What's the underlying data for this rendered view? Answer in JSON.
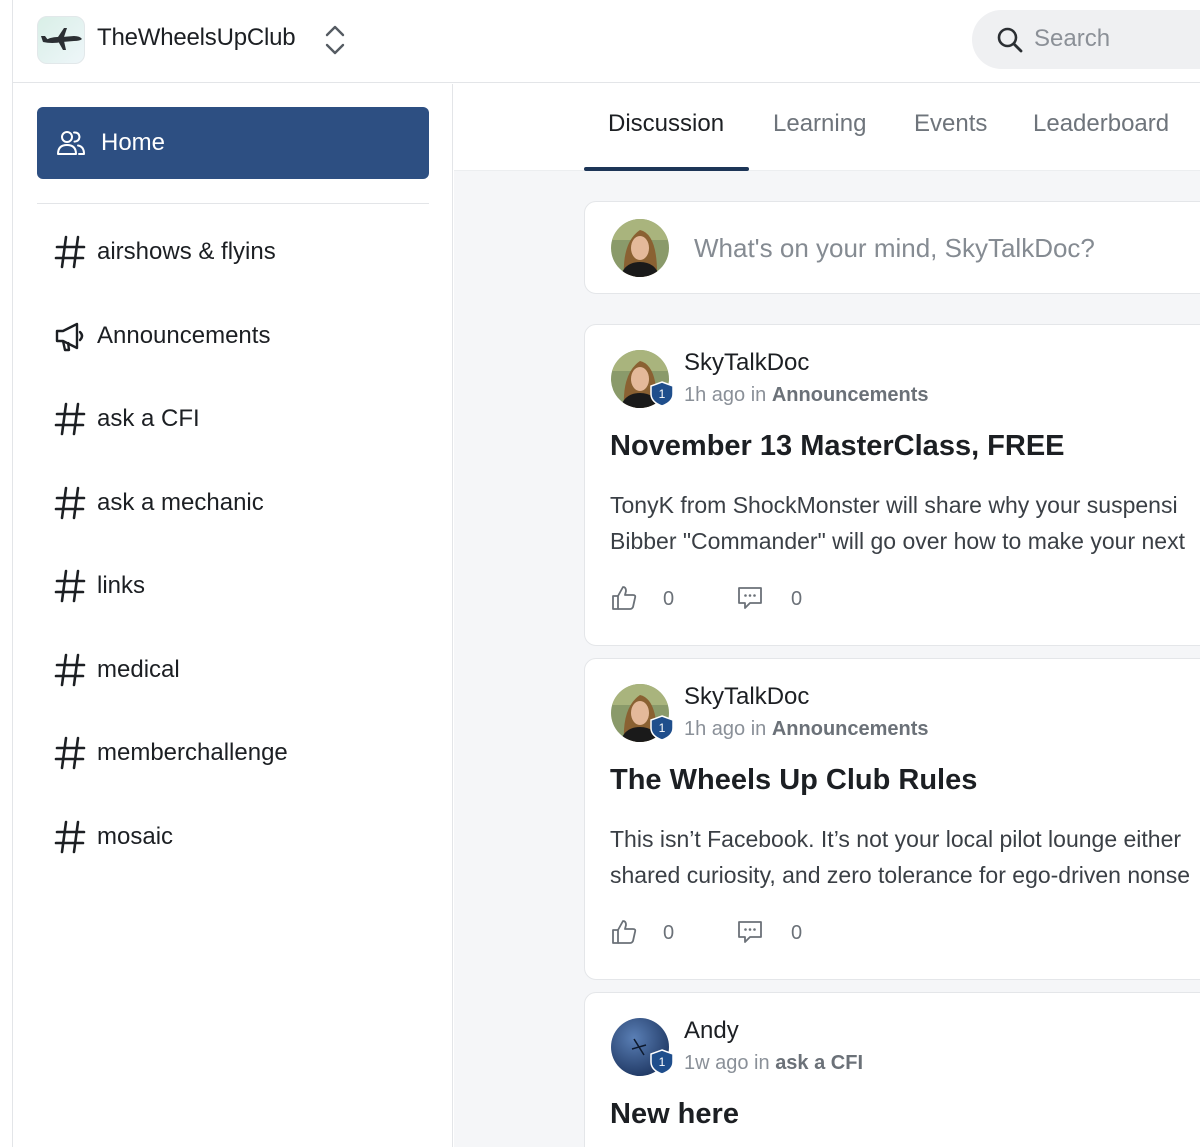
{
  "header": {
    "community_name": "TheWheelsUpClub",
    "search_placeholder": "Search"
  },
  "sidebar": {
    "home_label": "Home",
    "spaces": [
      {
        "label": "airshows & flyins",
        "icon": "hash-icon"
      },
      {
        "label": "Announcements",
        "icon": "megaphone-icon"
      },
      {
        "label": "ask a CFI",
        "icon": "hash-icon"
      },
      {
        "label": "ask a mechanic",
        "icon": "hash-icon"
      },
      {
        "label": "links",
        "icon": "hash-icon"
      },
      {
        "label": "medical",
        "icon": "hash-icon"
      },
      {
        "label": "memberchallenge",
        "icon": "hash-icon"
      },
      {
        "label": "mosaic",
        "icon": "hash-icon"
      }
    ]
  },
  "tabs": [
    {
      "label": "Discussion",
      "active": true
    },
    {
      "label": "Learning",
      "active": false
    },
    {
      "label": "Events",
      "active": false
    },
    {
      "label": "Leaderboard",
      "active": false
    }
  ],
  "composer": {
    "prompt": "What's on your mind, SkyTalkDoc?"
  },
  "posts": [
    {
      "author": "SkyTalkDoc",
      "level_badge": "1",
      "time": "1h ago in",
      "space": "Announcements",
      "title": "November 13 MasterClass, FREE",
      "body_line1": "TonyK from ShockMonster will share why your suspensi",
      "body_line2": "Bibber \"Commander\" will go over how to make your next",
      "likes": "0",
      "comments": "0"
    },
    {
      "author": "SkyTalkDoc",
      "level_badge": "1",
      "time": "1h ago in",
      "space": "Announcements",
      "title": "The Wheels Up Club Rules",
      "body_line1": "This isn’t Facebook. It’s not your local pilot lounge either",
      "body_line2": "shared curiosity, and zero tolerance for ego-driven nonse",
      "likes": "0",
      "comments": "0"
    },
    {
      "author": "Andy",
      "level_badge": "1",
      "time": "1w ago in",
      "space": "ask a CFI",
      "title": "New here"
    }
  ],
  "colors": {
    "accent": "#2d4f82",
    "tab_underline": "#1d3557",
    "badge": "#1f4e8c",
    "main_bg": "#f5f6f8"
  }
}
